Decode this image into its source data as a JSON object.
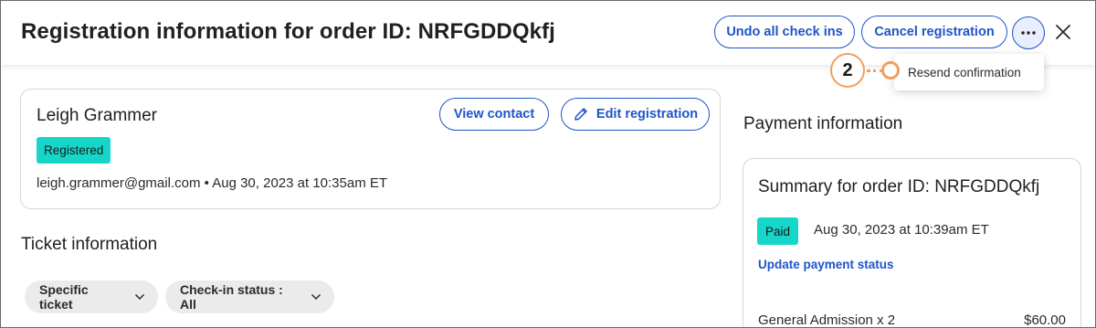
{
  "header": {
    "title": "Registration information for order ID: NRFGDDQkfj",
    "undo_label": "Undo all check ins",
    "cancel_label": "Cancel registration",
    "more_icon": "more-horizontal-icon",
    "close_icon": "close-icon"
  },
  "dropdown": {
    "items": [
      {
        "label": "Resend confirmation"
      }
    ]
  },
  "callout": {
    "number": "2",
    "color": "#f0a060"
  },
  "contact": {
    "name": "Leigh Grammer",
    "status": "Registered",
    "email": "leigh.grammer@gmail.com",
    "separator": "•",
    "registered_at": "Aug 30, 2023 at 10:35am ET",
    "view_label": "View contact",
    "edit_label": "Edit registration",
    "edit_icon": "pencil-icon"
  },
  "ticket": {
    "title": "Ticket information",
    "filters": [
      {
        "label": "Specific ticket"
      },
      {
        "label": "Check-in status : All"
      }
    ]
  },
  "payment": {
    "title": "Payment information",
    "summary_title": "Summary for order ID: NRFGDDQkfj",
    "status": "Paid",
    "paid_at": "Aug 30, 2023 at 10:39am ET",
    "update_label": "Update payment status",
    "line_items": [
      {
        "label": "General Admission x 2",
        "price": "$60.00"
      }
    ]
  },
  "colors": {
    "accent": "#1e55c8",
    "status_badge": "#15d6c8",
    "filter_bg": "#ebebeb"
  }
}
